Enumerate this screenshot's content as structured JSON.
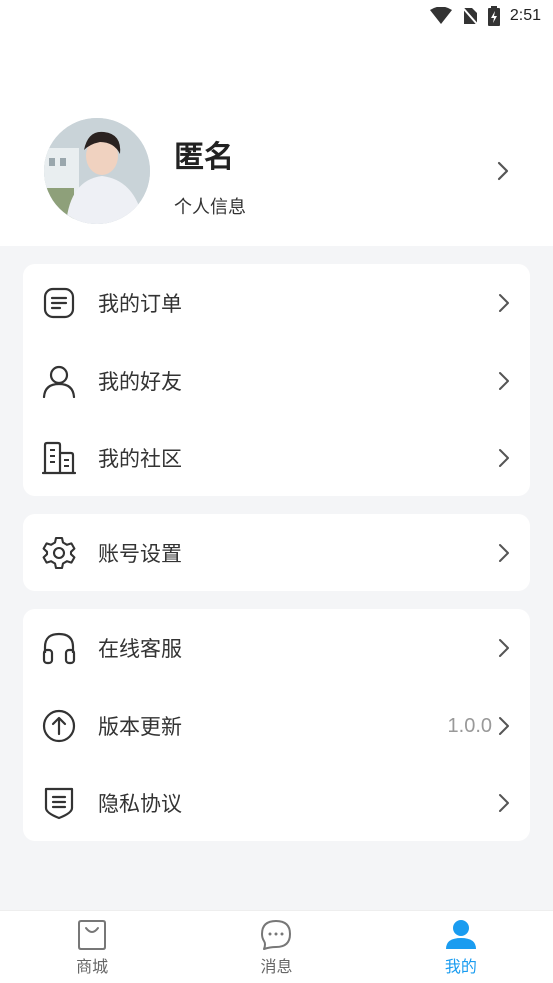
{
  "status_bar": {
    "time": "2:51",
    "icons": [
      "wifi-icon",
      "no-sim-icon",
      "battery-charging-icon"
    ]
  },
  "profile": {
    "name": "匿名",
    "subtitle": "个人信息"
  },
  "menu": {
    "orders": "我的订单",
    "friends": "我的好友",
    "community": "我的社区",
    "account_settings": "账号设置",
    "customer_service": "在线客服",
    "version_update": "版本更新",
    "version_value": "1.0.0",
    "privacy_policy": "隐私协议"
  },
  "tabs": [
    {
      "label": "商城",
      "icon": "shopping-bag-icon"
    },
    {
      "label": "消息",
      "icon": "chat-bubble-icon"
    },
    {
      "label": "我的",
      "icon": "user-icon",
      "active": true
    }
  ],
  "colors": {
    "accent": "#1a9cf0",
    "background": "#f4f5f7"
  }
}
